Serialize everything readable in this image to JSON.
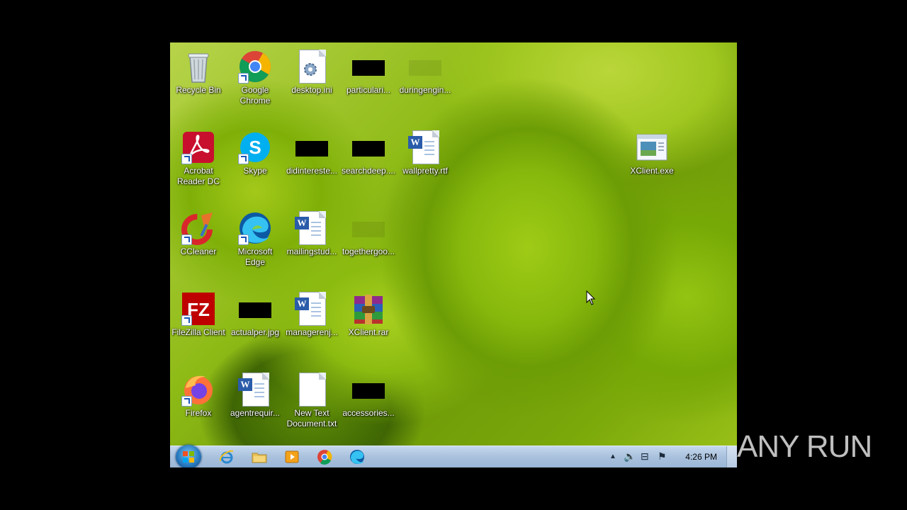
{
  "desktop": {
    "icons": [
      {
        "label": "Recycle Bin"
      },
      {
        "label": "Google Chrome"
      },
      {
        "label": "desktop.ini"
      },
      {
        "label": "particulari..."
      },
      {
        "label": "duringengin..."
      },
      {
        "label": "Acrobat Reader DC"
      },
      {
        "label": "Skype"
      },
      {
        "label": "didintereste..."
      },
      {
        "label": "searchdeep...."
      },
      {
        "label": "wallpretty.rtf"
      },
      {
        "label": "XClient.exe"
      },
      {
        "label": "CCleaner"
      },
      {
        "label": "Microsoft Edge"
      },
      {
        "label": "mailingstud..."
      },
      {
        "label": "togethergoo..."
      },
      {
        "label": "FileZilla Client"
      },
      {
        "label": "actualper.jpg"
      },
      {
        "label": "managerenj..."
      },
      {
        "label": "XClient.rar"
      },
      {
        "label": "Firefox"
      },
      {
        "label": "agentrequir..."
      },
      {
        "label": "New Text Document.txt"
      },
      {
        "label": "accessories..."
      }
    ]
  },
  "taskbar": {
    "pinned": [
      "internet-explorer-icon",
      "file-explorer-icon",
      "media-player-icon",
      "chrome-icon",
      "edge-icon"
    ],
    "clock": "4:26 PM"
  },
  "watermark": {
    "text": "ANY RUN"
  }
}
